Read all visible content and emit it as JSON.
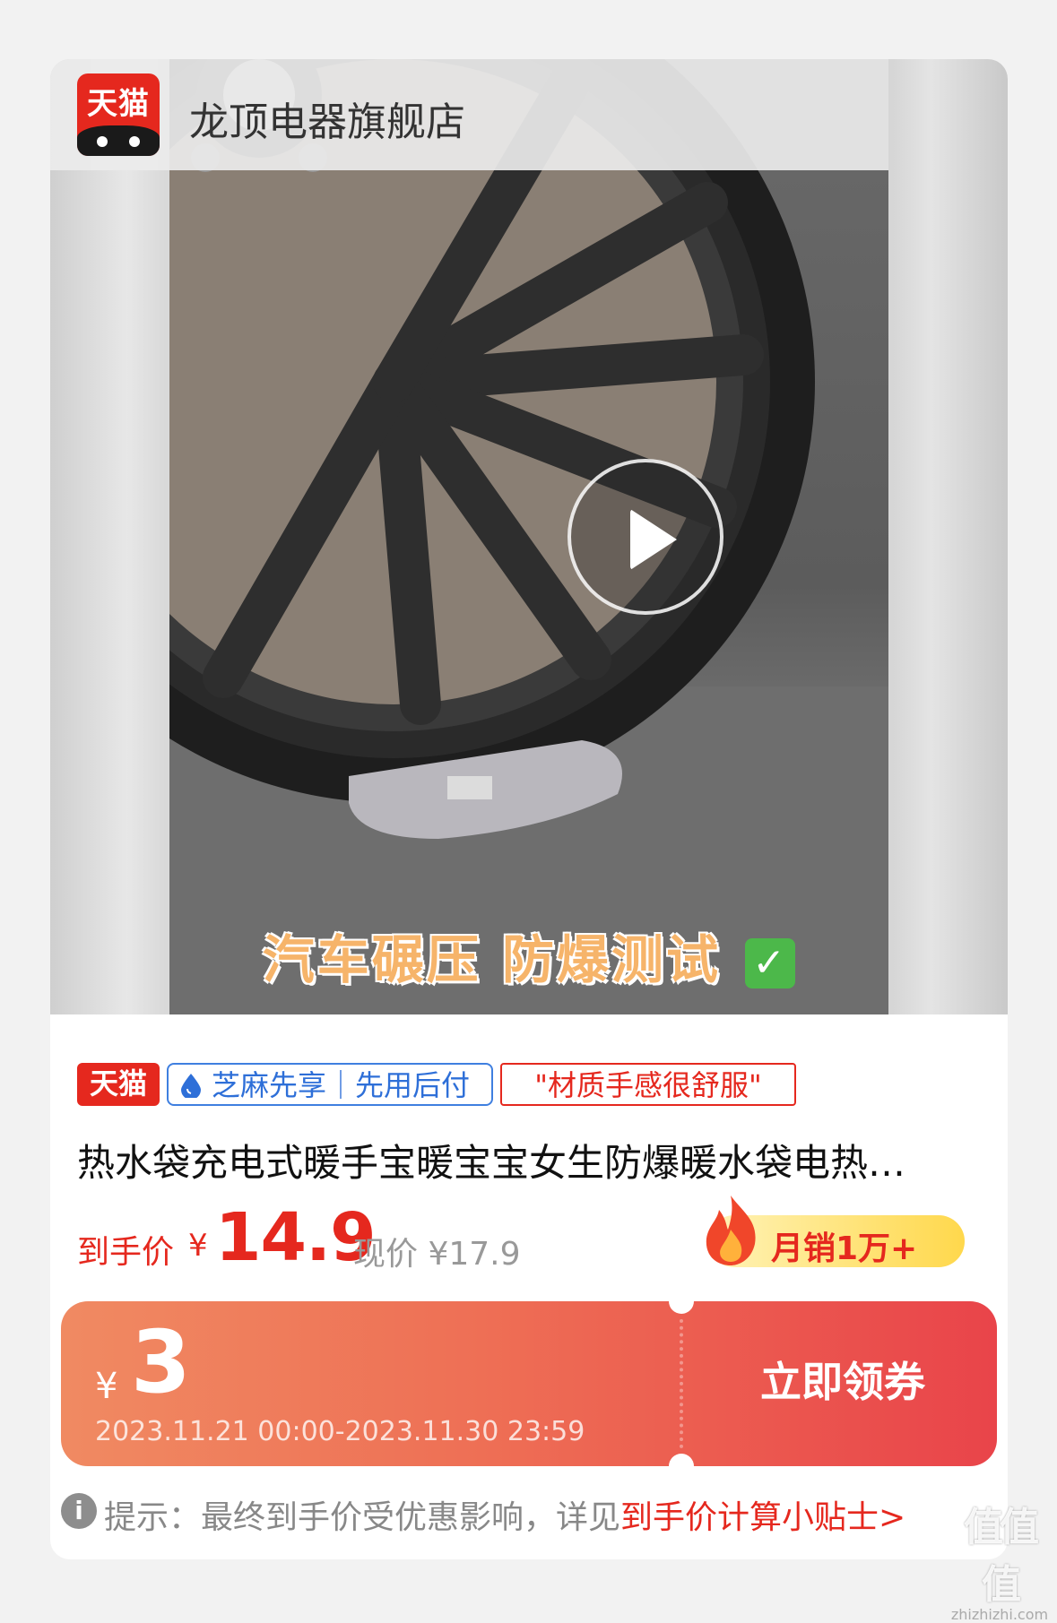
{
  "shop": {
    "logo_text": "天猫",
    "name": "龙顶电器旗舰店"
  },
  "video": {
    "caption": "汽车碾压 防爆测试",
    "caption_check": "✓"
  },
  "tags": {
    "tmall": "天猫",
    "zhima": "芝麻先享｜先用后付",
    "quote": "\"材质手感很舒服\""
  },
  "product": {
    "title": "热水袋充电式暖手宝暖宝宝女生防爆暖水袋电热…",
    "price_label": "到手价",
    "price_currency": "¥",
    "price_value": "14.9",
    "current_price": "现价 ¥17.9",
    "sales": "月销1万+"
  },
  "coupon": {
    "currency": "¥",
    "amount": "3",
    "validity": "2023.11.21 00:00-2023.11.30 23:59",
    "button_label": "立即领券"
  },
  "tip": {
    "icon": "i",
    "text": "提示：最终到手价受优惠影响，详见",
    "link": "到手价计算小贴士",
    "arrow": ">"
  },
  "watermark": {
    "mark": "值值值",
    "url": "zhizhizhi.com"
  },
  "colors": {
    "brand_red": "#e5281e",
    "coupon_start": "#f08a62",
    "coupon_end": "#e9444a",
    "zhima_blue": "#2e6fd8",
    "sales_yellow": "#ffd84c"
  }
}
